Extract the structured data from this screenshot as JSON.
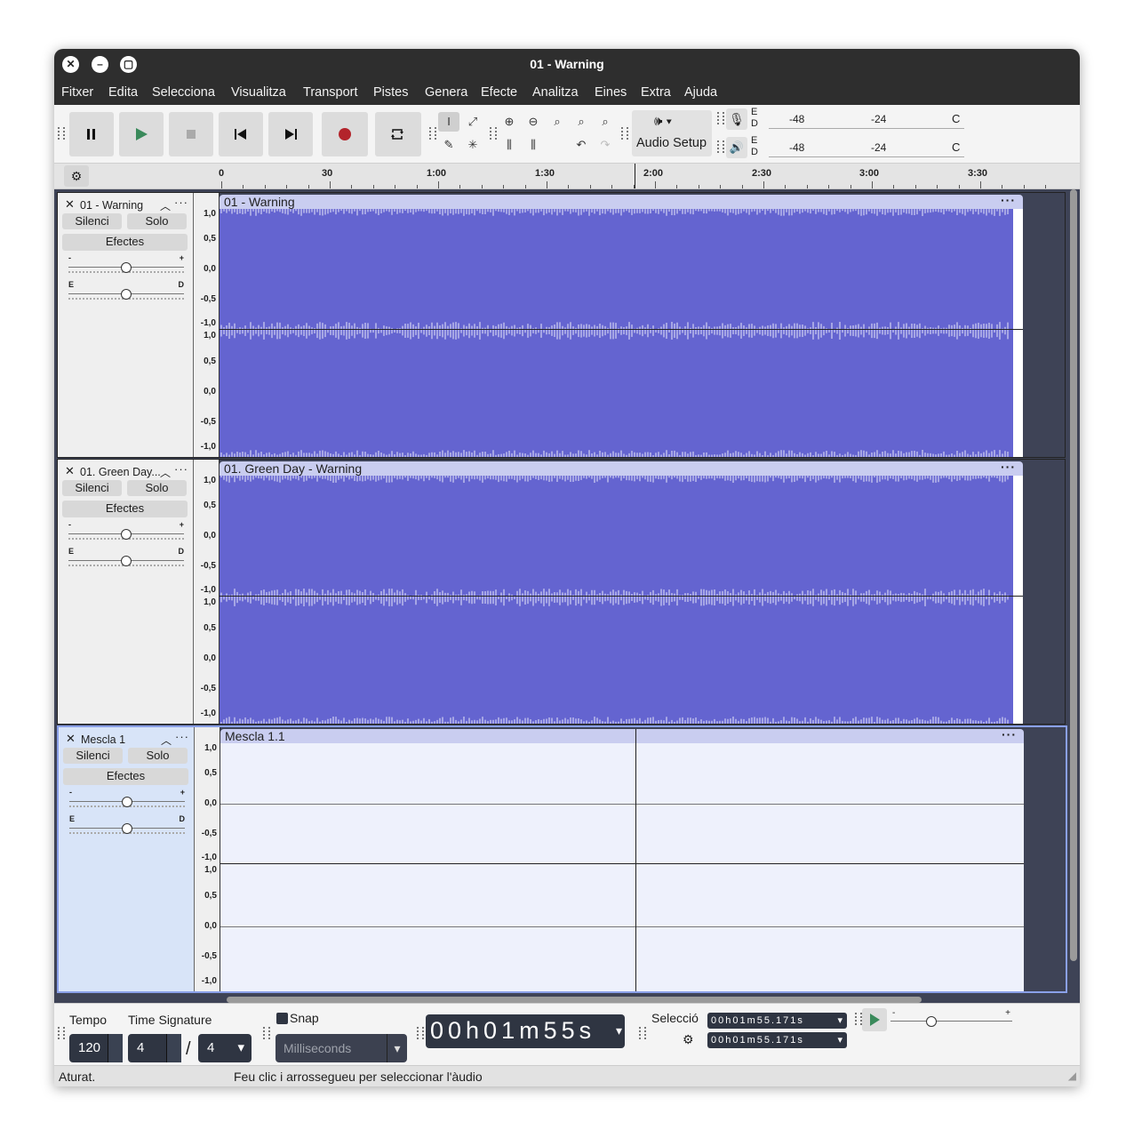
{
  "window": {
    "title": "01 - Warning"
  },
  "menu": [
    "Fitxer",
    "Edita",
    "Selecciona",
    "Visualitza",
    "Transport",
    "Pistes",
    "Genera",
    "Efecte",
    "Analitza",
    "Eines",
    "Extra",
    "Ajuda"
  ],
  "toolbar": {
    "audio_setup_label": "Audio Setup",
    "meter_rec": {
      "l": "E",
      "r": "D",
      "ticks": [
        "-48",
        "-24"
      ]
    },
    "meter_play": {
      "l": "E",
      "r": "D",
      "ticks": [
        "-48",
        "-24"
      ]
    }
  },
  "ruler": {
    "labels": [
      "0",
      "30",
      "1:00",
      "1:30",
      "2:00",
      "2:30",
      "3:00",
      "3:30"
    ]
  },
  "track_labels": {
    "mute": "Silenci",
    "solo": "Solo",
    "effects": "Efectes",
    "gain_minus": "-",
    "gain_plus": "+",
    "pan_left": "E",
    "pan_right": "D"
  },
  "scale": [
    "1,0",
    "0,5",
    "0,0",
    "-0,5",
    "-1,0"
  ],
  "tracks": [
    {
      "name": "01 - Warning",
      "clip": "01 - Warning"
    },
    {
      "name": "01. Green Day...",
      "clip": "01. Green Day - Warning"
    },
    {
      "name": "Mescla 1",
      "clip": "Mescla 1.1"
    }
  ],
  "bottom": {
    "tempo_label": "Tempo",
    "tempo_value": "120",
    "time_sig_label": "Time Signature",
    "time_sig_num": "4",
    "time_sig_sep": "/",
    "time_sig_den": "4",
    "snap_label": "Snap",
    "snap_unit_placeholder": "Milliseconds",
    "time_display": "00h01m55s",
    "selection_label": "Selecció",
    "sel_start": "00h01m55.171s",
    "sel_end": "00h01m55.171s"
  },
  "status": {
    "state": "Aturat.",
    "hint": "Feu clic i arrossegueu per seleccionar l'àudio"
  },
  "colors": {
    "waveform": "#6464d0",
    "clip_header": "#c9cdf0",
    "selected_track": "#d8e4f8",
    "record": "#b3242b",
    "play": "#3a8a5b"
  }
}
